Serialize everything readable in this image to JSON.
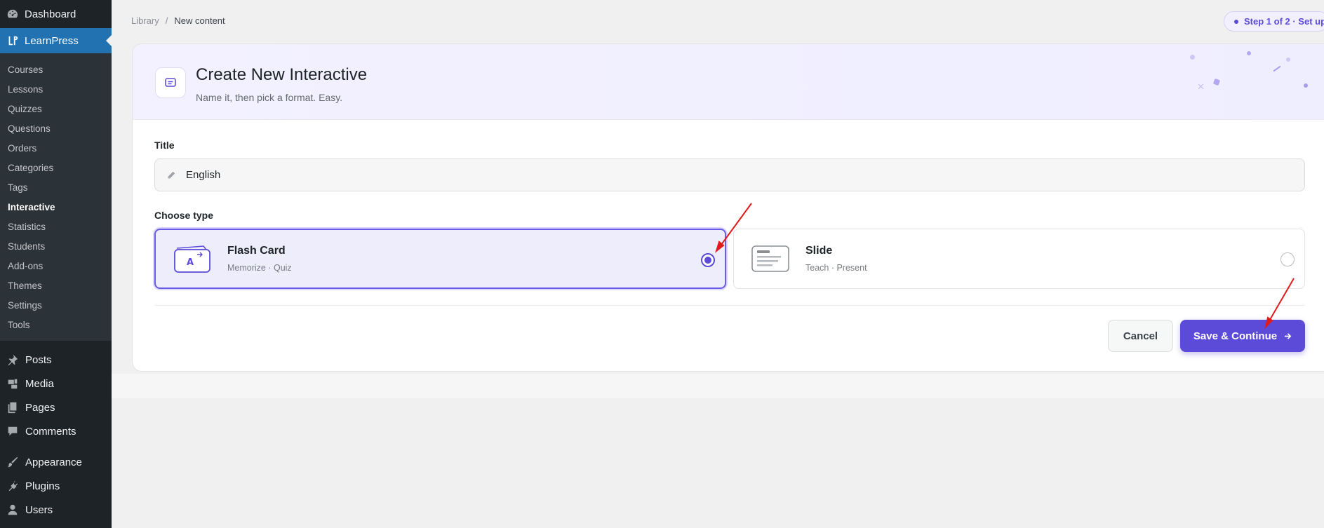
{
  "sidebar": {
    "dashboard_label": "Dashboard",
    "learnpress_label": "LearnPress",
    "submenu": [
      {
        "label": "Courses"
      },
      {
        "label": "Lessons"
      },
      {
        "label": "Quizzes"
      },
      {
        "label": "Questions"
      },
      {
        "label": "Orders"
      },
      {
        "label": "Categories"
      },
      {
        "label": "Tags"
      },
      {
        "label": "Interactive"
      },
      {
        "label": "Statistics"
      },
      {
        "label": "Students"
      },
      {
        "label": "Add-ons"
      },
      {
        "label": "Themes"
      },
      {
        "label": "Settings"
      },
      {
        "label": "Tools"
      }
    ],
    "menu": [
      {
        "label": "Posts",
        "icon": "pin-icon"
      },
      {
        "label": "Media",
        "icon": "media-icon"
      },
      {
        "label": "Pages",
        "icon": "pages-icon"
      },
      {
        "label": "Comments",
        "icon": "comment-icon"
      },
      {
        "label": "Appearance",
        "icon": "brush-icon"
      },
      {
        "label": "Plugins",
        "icon": "plug-icon"
      },
      {
        "label": "Users",
        "icon": "user-icon"
      }
    ],
    "current_submenu": "Interactive"
  },
  "breadcrumb": {
    "parent": "Library",
    "separator": "/",
    "current": "New content"
  },
  "step": {
    "label": "Step 1 of 2 · Set up"
  },
  "card": {
    "title": "Create New Interactive",
    "subtitle": "Name it, then pick a format. Easy."
  },
  "form": {
    "title_label": "Title",
    "title_value": "English",
    "type_label": "Choose type",
    "types": [
      {
        "name": "Flash Card",
        "desc": "Memorize · Quiz",
        "selected": true
      },
      {
        "name": "Slide",
        "desc": "Teach · Present",
        "selected": false
      }
    ],
    "cancel_label": "Cancel",
    "save_label": "Save & Continue"
  },
  "colors": {
    "accent": "#5b4bd8",
    "sidebar_bg": "#1d2327",
    "sidebar_active": "#2271b1",
    "annotation_arrow": "#e01b1b"
  }
}
